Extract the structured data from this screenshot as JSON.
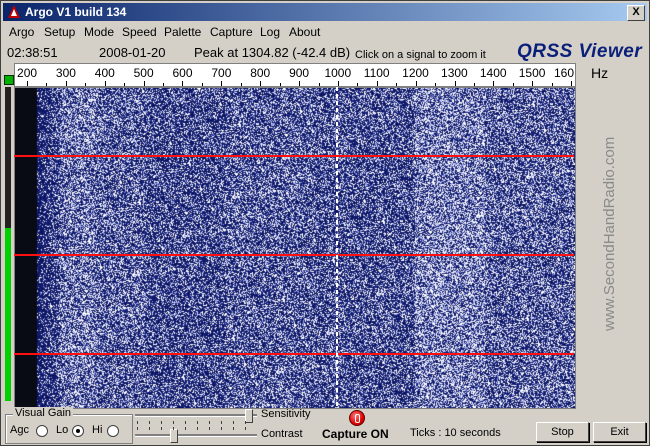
{
  "window": {
    "title": "Argo V1 build 134",
    "close_label": "X"
  },
  "menu": [
    "Argo",
    "Setup",
    "Mode",
    "Speed",
    "Palette",
    "Capture",
    "Log",
    "About"
  ],
  "status": {
    "time": "02:38:51",
    "date": "2008-01-20",
    "peak": "Peak at 1304.82 (-42.4 dB)",
    "hint": "Click on a signal to zoom it"
  },
  "logo": "QRSS Viewer",
  "unit": "Hz",
  "watermark": "www.SecondHandRadio.com",
  "scale": {
    "labels": [
      "200",
      "300",
      "400",
      "500",
      "600",
      "700",
      "800",
      "900",
      "1000",
      "1100",
      "1200",
      "1300",
      "1400",
      "1500",
      "160"
    ],
    "hz_start": 169,
    "hz_end": 1610
  },
  "waterfall": {
    "marker_hz": 1000,
    "colors": {
      "background": "#0b1460",
      "noise": "#ffffff",
      "line": "#ff1010"
    }
  },
  "level": {
    "fraction": 0.55
  },
  "controls": {
    "visual_gain": "Visual Gain",
    "agc": "Agc",
    "lo": "Lo",
    "hi": "Hi",
    "gain_selected": "Lo",
    "sensitivity": "Sensitivity",
    "contrast": "Contrast",
    "sensitivity_value": 0.95,
    "contrast_value": 0.3,
    "capture": "Capture ON",
    "ticks": "Ticks",
    "ticks_value": ": 10 seconds",
    "stop": "Stop",
    "exit": "Exit"
  }
}
